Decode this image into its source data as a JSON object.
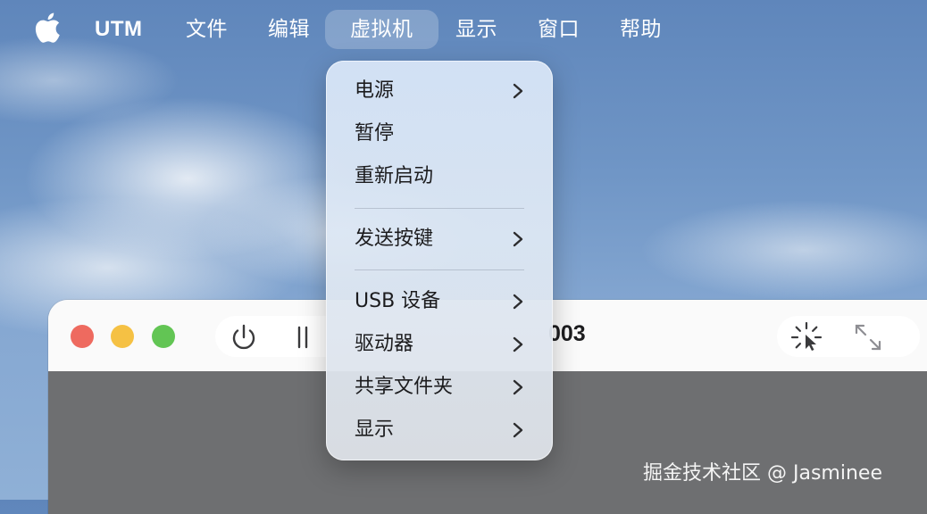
{
  "menubar": {
    "app_name": "UTM",
    "items": [
      "文件",
      "编辑",
      "虚拟机",
      "显示",
      "窗口",
      "帮助"
    ],
    "active_item": "虚拟机"
  },
  "dropdown": {
    "items": [
      {
        "label": "电源",
        "submenu": true
      },
      {
        "label": "暂停",
        "submenu": false
      },
      {
        "label": "重新启动",
        "submenu": false
      },
      {
        "label": "发送按键",
        "submenu": true
      },
      {
        "label": "USB 设备",
        "submenu": true
      },
      {
        "label": "驱动器",
        "submenu": true
      },
      {
        "label": "共享文件夹",
        "submenu": true
      },
      {
        "label": "显示",
        "submenu": true
      }
    ]
  },
  "vm_window": {
    "title_visible": "003",
    "toolbar_icons": [
      "power-icon",
      "pause-icon",
      "cursor-capture-icon",
      "fullscreen-icon"
    ]
  },
  "watermark": "掘金技术社区 @ Jasminee",
  "colors": {
    "traffic_red": "#ee6a5f",
    "traffic_yellow": "#f5c144",
    "traffic_green": "#62c554",
    "vm_screen": "#6e6f71"
  }
}
